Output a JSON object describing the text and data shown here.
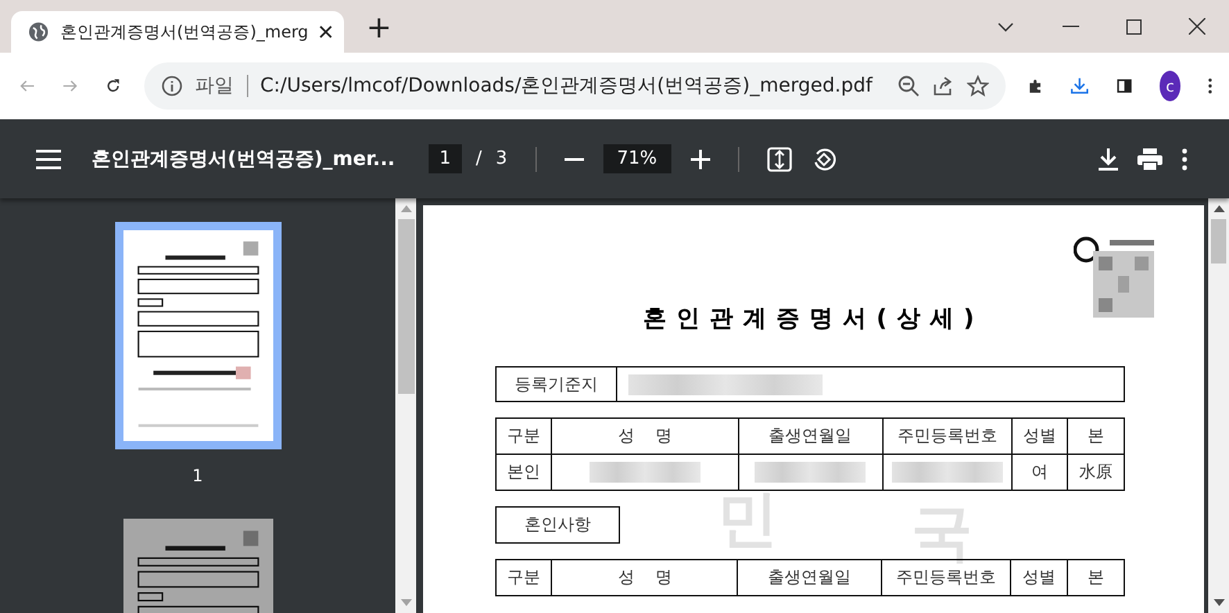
{
  "tab": {
    "title": "혼인관계증명서(번역공증)_merg",
    "new_tab": "+"
  },
  "address_bar": {
    "scheme_label": "파일",
    "url": "C:/Users/lmcof/Downloads/혼인관계증명서(번역공증)_merged.pdf"
  },
  "profile": {
    "initial": "c"
  },
  "pdf_toolbar": {
    "title": "혼인관계증명서(번역공증)_mer...",
    "page": "1",
    "separator": "/",
    "page_total": "3",
    "zoom": "71%"
  },
  "thumbnails": [
    {
      "label": "1",
      "selected": true
    },
    {
      "selected": false
    }
  ],
  "document": {
    "title": "혼인관계증명서(상세)",
    "registry_label": "등록기준지",
    "person_table": {
      "columns": [
        "구분",
        "성    명",
        "출생연월일",
        "주민등록번호",
        "성별",
        "본"
      ],
      "rows": [
        {
          "cells": [
            {
              "kind": "text",
              "text": "본인"
            },
            {
              "kind": "blurred"
            },
            {
              "kind": "blurred"
            },
            {
              "kind": "blurred"
            },
            {
              "kind": "text",
              "text": "여"
            },
            {
              "kind": "text",
              "text": "水原"
            }
          ]
        }
      ]
    },
    "section_label": "혼인사항",
    "marriage_table": {
      "columns": [
        "구분",
        "성    명",
        "출생연월일",
        "주민등록번호",
        "성별",
        "본"
      ]
    },
    "watermark": [
      "민",
      "국"
    ]
  }
}
